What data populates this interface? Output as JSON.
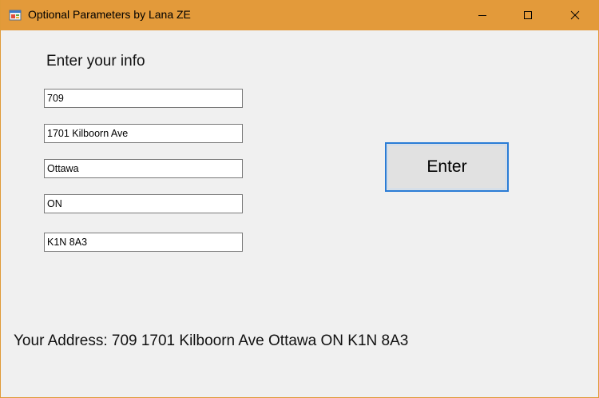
{
  "window": {
    "title": "Optional Parameters by Lana ZE",
    "icon": "form-app-icon",
    "titlebar_color": "#e39a3a"
  },
  "titlebar_controls": {
    "minimize_icon": "minimize-icon",
    "maximize_icon": "maximize-icon",
    "close_icon": "close-icon"
  },
  "form": {
    "heading": "Enter your info",
    "fields": [
      {
        "value": "709"
      },
      {
        "value": "1701 Kilboorn Ave"
      },
      {
        "value": "Ottawa"
      },
      {
        "value": "ON"
      },
      {
        "value": "K1N 8A3"
      }
    ],
    "enter_button": "Enter",
    "button_focus_color": "#2a7cd6"
  },
  "result": {
    "address_text": "Your Address: 709 1701 Kilboorn Ave Ottawa ON K1N 8A3"
  }
}
